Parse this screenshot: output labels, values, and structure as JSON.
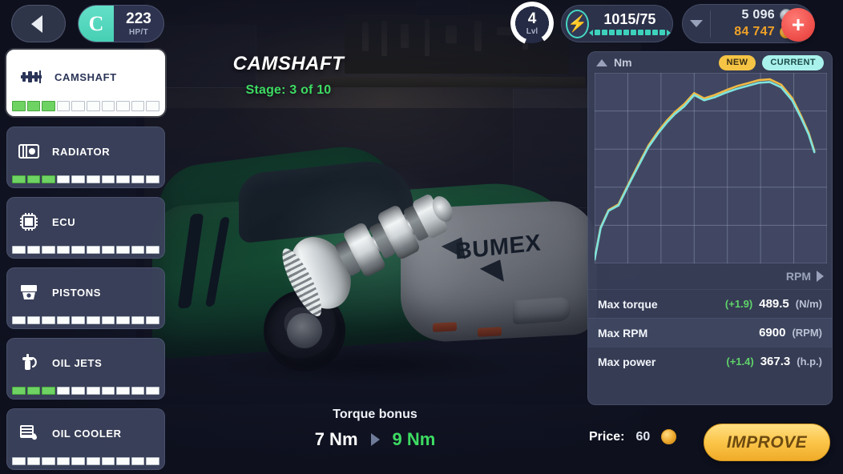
{
  "topbar": {
    "back_icon": "chevron-left-icon",
    "class_badge": {
      "letter": "C",
      "value": "223",
      "label": "HP/T"
    },
    "level": {
      "value": "4",
      "label": "Lvl",
      "ring_percent": 85
    },
    "energy": {
      "icon": "lightning-bolt-icon",
      "value": "1015/75",
      "segments": 10
    },
    "wallet": {
      "chevron_icon": "chevron-down-icon",
      "silver": "5 096",
      "gold": "84 747",
      "add_label": "+"
    }
  },
  "sidebar": {
    "items": [
      {
        "label": "CAMSHAFT",
        "icon": "camshaft-icon",
        "filled": 3,
        "total": 10,
        "selected": true
      },
      {
        "label": "RADIATOR",
        "icon": "radiator-icon",
        "filled": 3,
        "total": 10,
        "selected": false
      },
      {
        "label": "ECU",
        "icon": "ecu-chip-icon",
        "filled": 0,
        "total": 10,
        "selected": false
      },
      {
        "label": "PISTONS",
        "icon": "piston-icon",
        "filled": 0,
        "total": 10,
        "selected": false
      },
      {
        "label": "OIL JETS",
        "icon": "oil-jet-icon",
        "filled": 3,
        "total": 10,
        "selected": false
      },
      {
        "label": "OIL COOLER",
        "icon": "oil-cooler-icon",
        "filled": 0,
        "total": 10,
        "selected": false
      }
    ]
  },
  "center": {
    "part_title": "CAMSHAFT",
    "stage_text": "Stage: 3 of 10",
    "bonus_title": "Torque bonus",
    "bonus_current": "7 Nm",
    "bonus_next": "9 Nm",
    "bonus_arrow_icon": "arrow-right-icon"
  },
  "chart_panel": {
    "unit_label": "Nm",
    "collapse_icon": "triangle-up-icon",
    "badge_new": "NEW",
    "badge_current": "CURRENT",
    "axis_label": "RPM",
    "axis_arrow_icon": "triangle-right-icon",
    "stats": [
      {
        "name": "Max torque",
        "delta": "(+1.9)",
        "value": "489.5",
        "unit": "(N/m)"
      },
      {
        "name": "Max RPM",
        "delta": "",
        "value": "6900",
        "unit": "(RPM)"
      },
      {
        "name": "Max power",
        "delta": "(+1.4)",
        "value": "367.3",
        "unit": "(h.p.)"
      }
    ]
  },
  "purchase": {
    "price_label": "Price:",
    "price_value": "60",
    "coin_icon": "gold-coin-icon",
    "improve_label": "IMPROVE"
  },
  "colors": {
    "accent_teal": "#45d6c0",
    "accent_gold": "#f6c445",
    "accent_green": "#3ddb62",
    "accent_red": "#f0514c",
    "panel_bg": "#394059",
    "page_bg": "#171b2e"
  },
  "chart_data": {
    "type": "line",
    "title": "",
    "xlabel": "RPM",
    "ylabel": "Nm",
    "xlim": [
      0,
      7
    ],
    "ylim": [
      0,
      5
    ],
    "grid": true,
    "legend_position": "top-right",
    "series": [
      {
        "name": "CURRENT",
        "color": "#7fe3dd",
        "x": [
          0.0,
          0.18,
          0.42,
          0.72,
          1.02,
          1.3,
          1.62,
          1.92,
          2.18,
          2.42,
          2.7,
          3.0,
          3.3,
          3.62,
          3.95,
          4.28,
          4.62,
          4.95,
          5.28,
          5.62,
          5.95,
          6.22,
          6.45,
          6.62
        ],
        "y": [
          0.1,
          0.92,
          1.38,
          1.52,
          2.05,
          2.52,
          3.05,
          3.42,
          3.7,
          3.92,
          4.12,
          4.42,
          4.28,
          4.36,
          4.48,
          4.58,
          4.66,
          4.74,
          4.76,
          4.62,
          4.28,
          3.82,
          3.38,
          2.92
        ]
      },
      {
        "name": "NEW",
        "color": "#f0b944",
        "x": [
          0.0,
          0.18,
          0.42,
          0.72,
          1.02,
          1.3,
          1.62,
          1.92,
          2.18,
          2.42,
          2.7,
          3.0,
          3.3,
          3.62,
          3.95,
          4.28,
          4.62,
          4.95,
          5.28,
          5.62,
          5.95,
          6.22,
          6.45,
          6.62
        ],
        "y": [
          0.11,
          0.94,
          1.4,
          1.55,
          2.08,
          2.56,
          3.09,
          3.47,
          3.75,
          3.97,
          4.18,
          4.47,
          4.33,
          4.42,
          4.54,
          4.65,
          4.73,
          4.81,
          4.83,
          4.69,
          4.34,
          3.87,
          3.42,
          2.95
        ]
      }
    ]
  }
}
